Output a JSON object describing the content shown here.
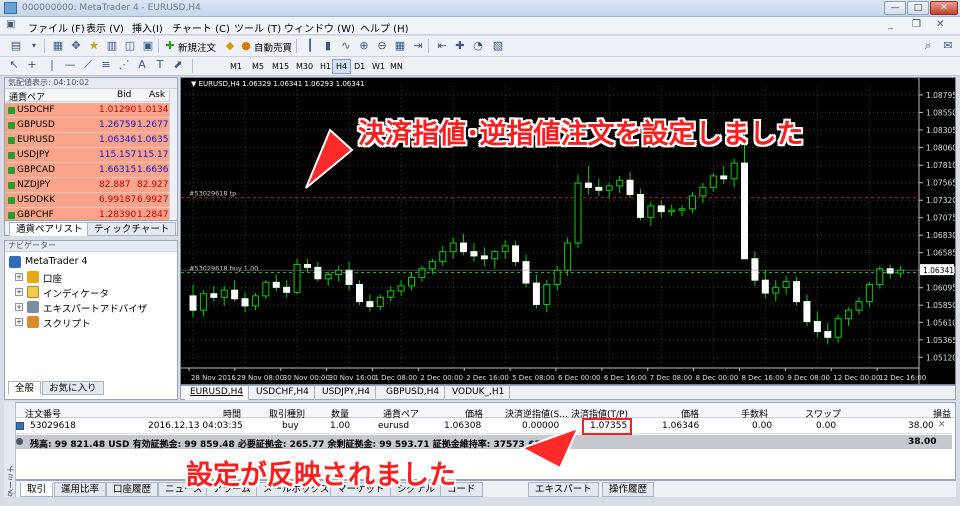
{
  "window": {
    "title": "000000000: MetaTrader 4 - EURUSD,H4",
    "min": "—",
    "max": "□",
    "close": "✕"
  },
  "menu": [
    "ファイル (F)",
    "表示 (V)",
    "挿入(I)",
    "チャート (C)",
    "ツール (T)",
    "ウィンドウ (W)",
    "ヘルプ (H)"
  ],
  "toolbar": {
    "new_order": "新規注文",
    "auto_trade": "自動売買"
  },
  "timeframes": [
    "M1",
    "M5",
    "M15",
    "M30",
    "H1",
    "H4",
    "D1",
    "W1",
    "MN"
  ],
  "timeframe_selected": "H4",
  "market_watch": {
    "header": "気配値表示: 04:10:02",
    "columns": {
      "symbol": "通貨ペア",
      "bid": "Bid",
      "ask": "Ask"
    },
    "rows": [
      {
        "symbol": "USDCHF",
        "bid": "1.01290",
        "ask": "1.01340",
        "color": "red"
      },
      {
        "symbol": "GBPUSD",
        "bid": "1.26759",
        "ask": "1.26772",
        "color": "blue"
      },
      {
        "symbol": "EURUSD",
        "bid": "1.06346",
        "ask": "1.06354",
        "color": "blue"
      },
      {
        "symbol": "USDJPY",
        "bid": "115.157",
        "ask": "115.170",
        "color": "blue"
      },
      {
        "symbol": "GBPCAD",
        "bid": "1.66315",
        "ask": "1.66365",
        "color": "blue"
      },
      {
        "symbol": "NZDJPY",
        "bid": "82.887",
        "ask": "82.927",
        "color": "red"
      },
      {
        "symbol": "USDDKK",
        "bid": "6.99187",
        "ask": "6.99277",
        "color": "red"
      },
      {
        "symbol": "GBPCHF",
        "bid": "1.28390",
        "ask": "1.28470",
        "color": "red"
      }
    ],
    "tabs": [
      "通貨ペアリスト",
      "ティックチャート"
    ]
  },
  "navigator": {
    "header": "ナビゲーター",
    "root": "MetaTrader 4",
    "items": [
      "口座",
      "インディケータ",
      "エキスパートアドバイザ",
      "スクリプト"
    ],
    "tabs": [
      "全般",
      "お気に入り"
    ]
  },
  "chart": {
    "info": "EURUSD,H4  1.06329 1.06341 1.06293 1.06341",
    "tp_label": "#53029618 tp",
    "buy_label": "#53029618 buy 1.00",
    "price_ticks": [
      "1.08795",
      "1.08550",
      "1.08305",
      "1.08060",
      "1.07810",
      "1.07565",
      "1.07320",
      "1.07075",
      "1.06830",
      "1.06585",
      "1.06341",
      "1.06095",
      "1.05850",
      "1.05610",
      "1.05365",
      "1.05120"
    ],
    "current_price": "1.06341",
    "tp_price": 1.07355,
    "buy_price": 1.06308,
    "time_ticks": [
      "28 Nov 2016",
      "29 Nov 08:00",
      "30 Nov 00:00",
      "30 Nov 16:00",
      "1 Dec 08:00",
      "2 Dec 00:00",
      "2 Dec 16:00",
      "5 Dec 08:00",
      "6 Dec 00:00",
      "6 Dec 16:00",
      "7 Dec 08:00",
      "8 Dec 00:00",
      "8 Dec 16:00",
      "9 Dec 08:00",
      "12 Dec 00:00",
      "12 Dec 16:00"
    ],
    "tabs": [
      "EURUSD,H4",
      "USDCHF,H4",
      "USDJPY,H4",
      "GBPUSD,H4",
      "VODUK_,H1"
    ]
  },
  "chart_data": {
    "type": "candlestick",
    "ylim": [
      1.0497,
      1.0892
    ],
    "candles": [
      [
        1.0598,
        1.0614,
        1.0568,
        1.0578
      ],
      [
        1.0578,
        1.0606,
        1.0569,
        1.0601
      ],
      [
        1.0601,
        1.0612,
        1.059,
        1.0596
      ],
      [
        1.0596,
        1.0612,
        1.0584,
        1.0606
      ],
      [
        1.0606,
        1.062,
        1.059,
        1.0594
      ],
      [
        1.0594,
        1.0603,
        1.0575,
        1.0584
      ],
      [
        1.0584,
        1.0602,
        1.0578,
        1.0598
      ],
      [
        1.0598,
        1.062,
        1.0594,
        1.0617
      ],
      [
        1.0617,
        1.0628,
        1.0604,
        1.061
      ],
      [
        1.061,
        1.062,
        1.0596,
        1.0603
      ],
      [
        1.0603,
        1.065,
        1.06,
        1.0642
      ],
      [
        1.0642,
        1.065,
        1.063,
        1.0638
      ],
      [
        1.0638,
        1.0646,
        1.0618,
        1.0622
      ],
      [
        1.0622,
        1.0632,
        1.0612,
        1.0628
      ],
      [
        1.0628,
        1.064,
        1.0618,
        1.0634
      ],
      [
        1.0634,
        1.0646,
        1.0606,
        1.0614
      ],
      [
        1.0614,
        1.062,
        1.0585,
        1.059
      ],
      [
        1.059,
        1.06,
        1.0576,
        1.0583
      ],
      [
        1.0583,
        1.06,
        1.0578,
        1.0596
      ],
      [
        1.0596,
        1.0612,
        1.059,
        1.0605
      ],
      [
        1.0605,
        1.062,
        1.0598,
        1.0612
      ],
      [
        1.0612,
        1.063,
        1.0606,
        1.0624
      ],
      [
        1.0624,
        1.064,
        1.0618,
        1.0636
      ],
      [
        1.0636,
        1.065,
        1.0628,
        1.0646
      ],
      [
        1.0646,
        1.0668,
        1.064,
        1.066
      ],
      [
        1.066,
        1.068,
        1.065,
        1.0672
      ],
      [
        1.0672,
        1.0685,
        1.0655,
        1.066
      ],
      [
        1.066,
        1.0672,
        1.0646,
        1.0654
      ],
      [
        1.0654,
        1.0666,
        1.064,
        1.065
      ],
      [
        1.065,
        1.0662,
        1.0636,
        1.066
      ],
      [
        1.066,
        1.0676,
        1.065,
        1.0668
      ],
      [
        1.0668,
        1.0675,
        1.064,
        1.0646
      ],
      [
        1.0646,
        1.0656,
        1.061,
        1.0616
      ],
      [
        1.0616,
        1.0628,
        1.058,
        1.0586
      ],
      [
        1.0586,
        1.062,
        1.0575,
        1.0614
      ],
      [
        1.0614,
        1.064,
        1.0606,
        1.0634
      ],
      [
        1.0634,
        1.068,
        1.0626,
        1.0672
      ],
      [
        1.0672,
        1.0768,
        1.0665,
        1.0756
      ],
      [
        1.0756,
        1.078,
        1.074,
        1.075
      ],
      [
        1.075,
        1.0762,
        1.0738,
        1.0746
      ],
      [
        1.0746,
        1.0756,
        1.0736,
        1.0752
      ],
      [
        1.0752,
        1.0766,
        1.0742,
        1.076
      ],
      [
        1.076,
        1.0772,
        1.0735,
        1.074
      ],
      [
        1.074,
        1.0748,
        1.0704,
        1.0708
      ],
      [
        1.0708,
        1.073,
        1.0696,
        1.0724
      ],
      [
        1.0724,
        1.0732,
        1.0708,
        1.0716
      ],
      [
        1.0716,
        1.0726,
        1.071,
        1.0718
      ],
      [
        1.0718,
        1.0725,
        1.071,
        1.072
      ],
      [
        1.072,
        1.0744,
        1.0714,
        1.0738
      ],
      [
        1.0738,
        1.0756,
        1.0728,
        1.075
      ],
      [
        1.075,
        1.077,
        1.0744,
        1.0766
      ],
      [
        1.0766,
        1.078,
        1.0755,
        1.0762
      ],
      [
        1.0762,
        1.079,
        1.075,
        1.0784
      ],
      [
        1.0784,
        1.0842,
        1.077,
        1.065
      ],
      [
        1.065,
        1.066,
        1.0612,
        1.062
      ],
      [
        1.062,
        1.0634,
        1.0595,
        1.0602
      ],
      [
        1.0602,
        1.062,
        1.059,
        1.061
      ],
      [
        1.061,
        1.0626,
        1.06,
        1.0618
      ],
      [
        1.0618,
        1.0625,
        1.0585,
        1.059
      ],
      [
        1.059,
        1.06,
        1.0556,
        1.0562
      ],
      [
        1.0562,
        1.0576,
        1.054,
        1.0548
      ],
      [
        1.0548,
        1.056,
        1.053,
        1.054
      ],
      [
        1.054,
        1.0572,
        1.0532,
        1.0566
      ],
      [
        1.0566,
        1.0582,
        1.0556,
        1.0578
      ],
      [
        1.0578,
        1.0596,
        1.0572,
        1.059
      ],
      [
        1.059,
        1.0618,
        1.0582,
        1.0614
      ],
      [
        1.0614,
        1.064,
        1.0608,
        1.0636
      ],
      [
        1.0636,
        1.0642,
        1.0622,
        1.063
      ],
      [
        1.063,
        1.064,
        1.0624,
        1.0634
      ]
    ]
  },
  "terminal": {
    "side_label": "ターミナル",
    "columns": [
      "注文番号",
      "時間",
      "取引種別",
      "数量",
      "通貨ペア",
      "価格",
      "決済逆指値(S...",
      "決済指値(T/P)",
      "価格",
      "手数料",
      "スワップ",
      "損益"
    ],
    "order": {
      "id": "53029618",
      "time": "2016.12.13 04:03:35",
      "type": "buy",
      "volume": "1.00",
      "symbol": "eurusd",
      "price": "1.06308",
      "sl": "0.00000",
      "tp": "1.07355",
      "cur_price": "1.06346",
      "commission": "0.00",
      "swap": "0.00",
      "profit": "38.00"
    },
    "balance_line": "残高: 99 821.48 USD  有効証拠金: 99 859.48  必要証拠金: 265.77  余剰証拠金: 99 593.71  証拠金維持率: 37573.65%",
    "balance_profit": "38.00",
    "tabs": [
      "取引",
      "運用比率",
      "口座履歴",
      "ニュース",
      "アラーム",
      "メールボックス",
      "マーケット",
      "シグナル",
      "コード",
      "エキスパート",
      "操作履歴"
    ]
  },
  "annotations": {
    "top": "決済指値･逆指値注文を設定しました",
    "bottom": "設定が反映されました"
  },
  "colors": {
    "annotation": "#ff1e1e",
    "bull": "#00c000",
    "bear": "#ffffff",
    "quote_bg": "#f9a48a"
  }
}
